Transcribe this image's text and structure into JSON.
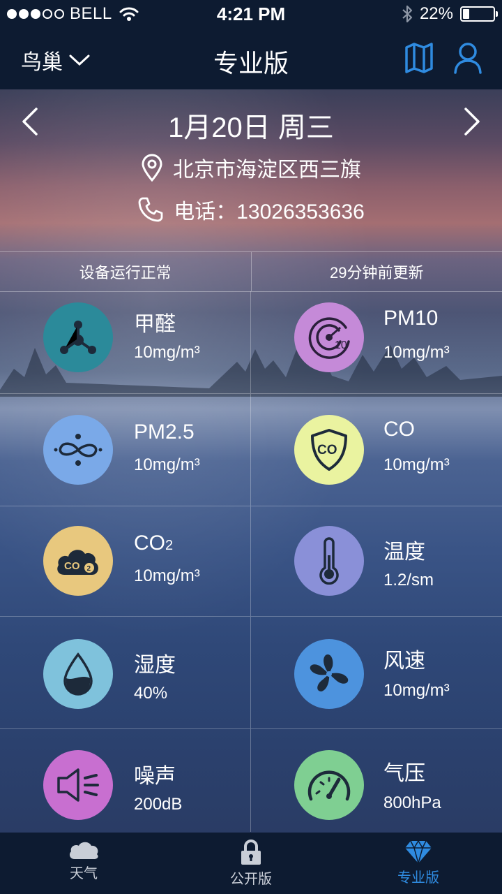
{
  "status_bar": {
    "carrier": "BELL",
    "time": "4:21 PM",
    "battery_percent": "22%",
    "battery_level": 0.22,
    "signal_bars_filled": 3,
    "signal_bars_total": 5
  },
  "nav": {
    "location": "鸟巢",
    "title": "专业版",
    "icons": [
      "map-icon",
      "user-icon"
    ],
    "accent_color": "#2f8be0"
  },
  "header": {
    "date": "1月20日 周三",
    "address": "北京市海淀区西三旗",
    "phone": "电话：13026353636"
  },
  "device_status": {
    "left": "设备运行正常",
    "right": "29分钟前更新"
  },
  "metrics": [
    {
      "name": "甲醛",
      "value": "10mg/m³",
      "icon": "molecule-icon",
      "color": "#2b8a9a"
    },
    {
      "name": "PM10",
      "value": "10mg/m³",
      "icon": "radar-icon",
      "color": "#c58ad8"
    },
    {
      "name": "PM2.5",
      "value": "10mg/m³",
      "icon": "infinity-particles-icon",
      "color": "#7aa9e8"
    },
    {
      "name": "CO",
      "value": "10mg/m³",
      "icon": "co-shield-icon",
      "color": "#eaf3a0"
    },
    {
      "name_main": "CO",
      "name_sub": "2",
      "value": "10mg/m³",
      "icon": "co2-cloud-icon",
      "color": "#e8c87e"
    },
    {
      "name": "温度",
      "value": "1.2/sm",
      "icon": "thermometer-icon",
      "color": "#8a90d8"
    },
    {
      "name": "湿度",
      "value": "40%",
      "icon": "water-drop-icon",
      "color": "#7fc2dc"
    },
    {
      "name": "风速",
      "value": "10mg/m³",
      "icon": "fan-icon",
      "color": "#4d93de"
    },
    {
      "name": "噪声",
      "value": "200dB",
      "icon": "speaker-icon",
      "color": "#c86fd0"
    },
    {
      "name": "气压",
      "value": "800hPa",
      "icon": "gauge-icon",
      "color": "#7fcf92"
    }
  ],
  "tabs": [
    {
      "label": "天气",
      "icon": "cloud-icon",
      "active": false
    },
    {
      "label": "公开版",
      "icon": "lock-icon",
      "active": false
    },
    {
      "label": "专业版",
      "icon": "diamond-icon",
      "active": true
    }
  ]
}
